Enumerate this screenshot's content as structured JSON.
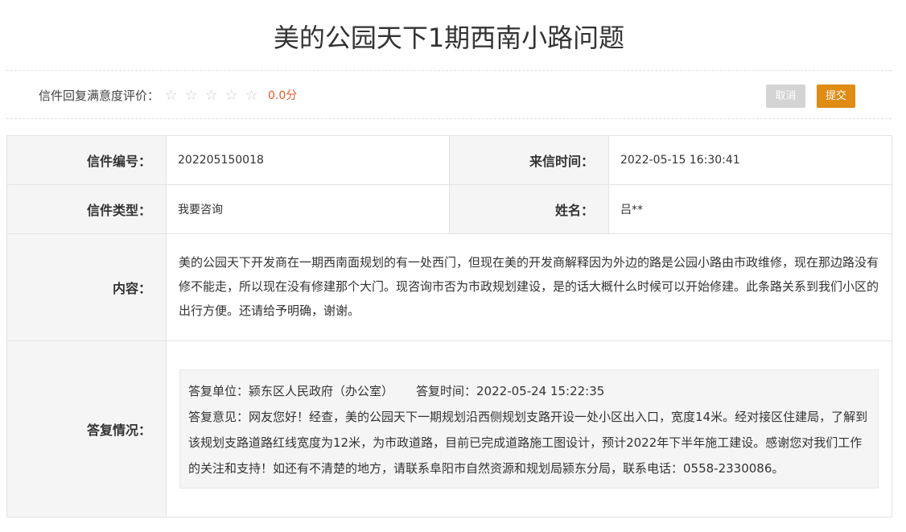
{
  "page": {
    "title": "美的公园天下1期西南小路问题"
  },
  "rating": {
    "label": "信件回复满意度评价：",
    "star_icon": "☆",
    "max_stars": 5,
    "selected_stars": 0,
    "score_text": "0.0分"
  },
  "actions": {
    "cancel_label": "取消",
    "submit_label": "提交",
    "submit_color": "#e08b14",
    "cancel_color": "#d4d4d4"
  },
  "letter": {
    "number_label": "信件编号：",
    "number_value": "202205150018",
    "time_label": "来信时间：",
    "time_value": "2022-05-15 16:30:41",
    "type_label": "信件类型：",
    "type_value": "我要咨询",
    "name_label": "姓名：",
    "name_value": "吕**",
    "content_label": "内容：",
    "content_value": "美的公园天下开发商在一期西南面规划的有一处西门，但现在美的开发商解释因为外边的路是公园小路由市政维修，现在那边路没有修不能走，所以现在没有修建那个大门。现咨询市否为市政规划建设，是的话大概什么时候可以开始修建。此条路关系到我们小区的出行方便。还请给予明确，谢谢。"
  },
  "reply": {
    "label": "答复情况：",
    "unit_text": "答复单位：颍东区人民政府（办公室）",
    "time_text": "答复时间：2022-05-24 15:22:35",
    "opinion_text": "答复意见：网友您好！经查，美的公园天下一期规划沿西侧规划支路开设一处小区出入口，宽度14米。经对接区住建局，了解到该规划支路道路红线宽度为12米，为市政道路，目前已完成道路施工图设计，预计2022年下半年施工建设。感谢您对我们工作的关注和支持！如还有不清楚的地方，请联系阜阳市自然资源和规划局颍东分局，联系电话：0558-2330086。"
  }
}
